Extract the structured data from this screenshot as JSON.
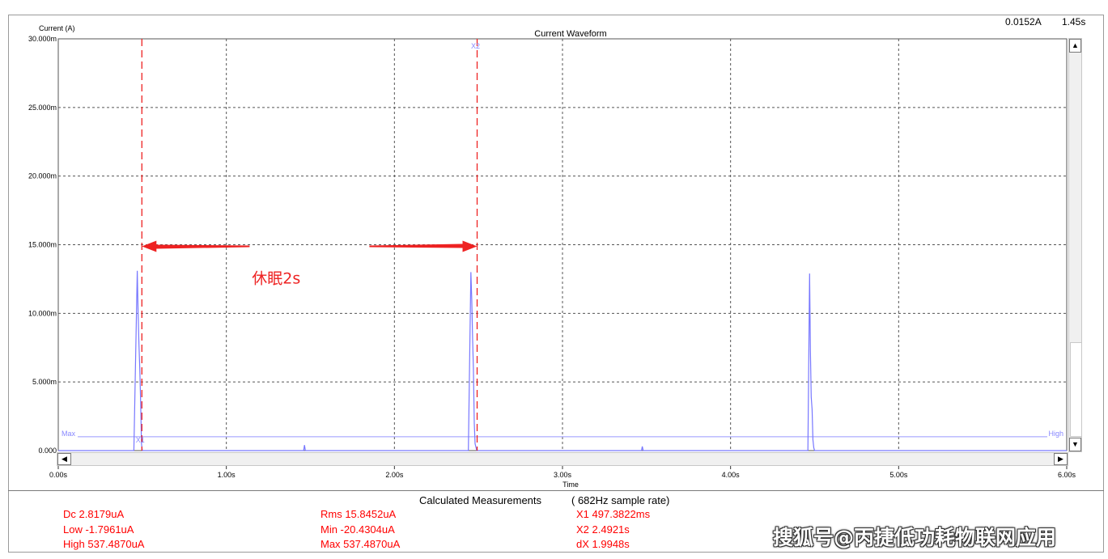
{
  "readout": {
    "value": "0.0152A",
    "time": "1.45s"
  },
  "measurements": {
    "title": "Calculated Measurements",
    "rate": "( 682Hz sample rate)",
    "col1": [
      "Dc  2.8179uA",
      "Low -1.7961uA",
      "High 537.4870uA"
    ],
    "col2": [
      "Rms 15.8452uA",
      "Min -20.4304uA",
      "Max 537.4870uA"
    ],
    "col3": [
      "X1 497.3822ms",
      "X2  2.4921s",
      "dX  1.9948s"
    ]
  },
  "watermark": "搜狐号@丙捷低功耗物联网应用",
  "colors": {
    "trace": "#7777ff",
    "annotation": "#ee2222",
    "measure_text": "#ff0000"
  },
  "icons": {
    "scroll_up": "triangle-up-icon",
    "scroll_down": "triangle-down-icon",
    "scroll_left": "triangle-left-icon",
    "scroll_right": "triangle-right-icon"
  },
  "chart_data": {
    "type": "line",
    "title": "Current Waveform",
    "ylabel": "Current (A)",
    "xlabel": "Time",
    "xlim": [
      0,
      6
    ],
    "ylim": [
      0,
      0.03
    ],
    "x_ticks": [
      0,
      1,
      2,
      3,
      4,
      5,
      6
    ],
    "x_tick_labels": [
      "0.00s",
      "1.00s",
      "2.00s",
      "3.00s",
      "4.00s",
      "5.00s",
      "6.00s"
    ],
    "y_ticks": [
      0,
      0.005,
      0.01,
      0.015,
      0.02,
      0.025,
      0.03
    ],
    "y_tick_labels": [
      "0.000",
      "5.000m",
      "10.000m",
      "15.000m",
      "20.000m",
      "25.000m",
      "30.000m"
    ],
    "grid": true,
    "series": [
      {
        "x": [
          0,
          0.45,
          0.47,
          0.475,
          0.48,
          0.485,
          0.49,
          0.495,
          0.5,
          0.51,
          0.52,
          1.46,
          1.465,
          1.47,
          2.44,
          2.455,
          2.46,
          2.465,
          2.47,
          2.475,
          2.48,
          2.49,
          3.47,
          3.475,
          3.48,
          4.46,
          4.47,
          4.475,
          4.48,
          4.485,
          4.49,
          4.495,
          4.5,
          6
        ],
        "y": [
          0,
          0,
          0.0131,
          0.0102,
          0.0077,
          0.006,
          0.0035,
          0.0005,
          0,
          0,
          0,
          0,
          0.0004,
          0,
          0,
          0.013,
          0.011,
          0.0082,
          0.006,
          0.002,
          0.0005,
          0,
          0,
          0.0003,
          0,
          0,
          0.0129,
          0.0073,
          0.0039,
          0.003,
          0.0008,
          0.0002,
          0,
          0
        ]
      }
    ],
    "cursors": [
      {
        "name": "X1",
        "x": 0.4974
      },
      {
        "name": "X2",
        "x": 2.4921
      }
    ],
    "level_lines": [
      {
        "left_label": "Max",
        "right_label": "High",
        "y": 0.000537
      }
    ],
    "annotations": [
      {
        "text": "休眠2s",
        "x_from": 0.4974,
        "x_to": 2.4921,
        "y": 0.015
      }
    ]
  }
}
